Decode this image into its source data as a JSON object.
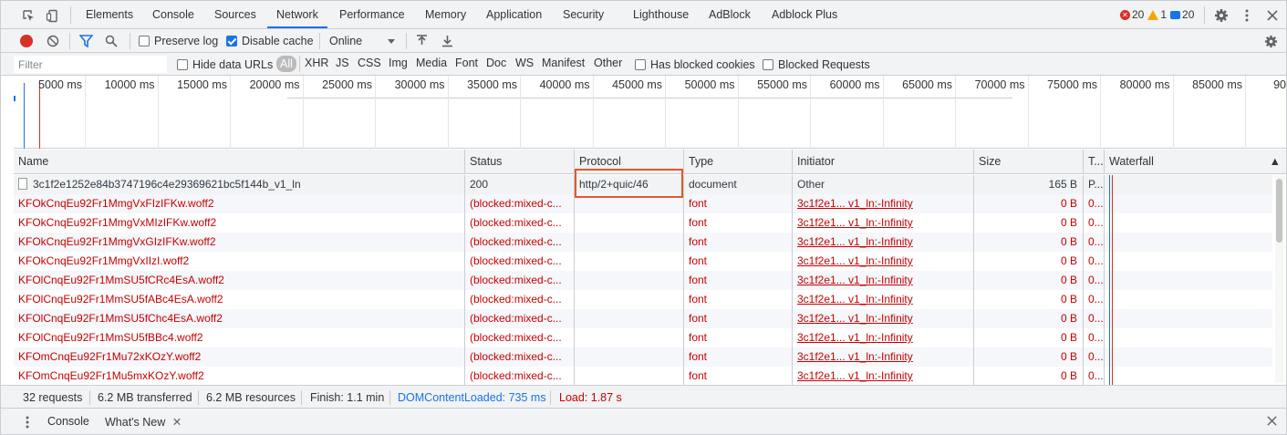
{
  "tabs": [
    {
      "label": "Elements"
    },
    {
      "label": "Console"
    },
    {
      "label": "Sources"
    },
    {
      "label": "Network"
    },
    {
      "label": "Performance"
    },
    {
      "label": "Memory"
    },
    {
      "label": "Application"
    },
    {
      "label": "Security"
    },
    {
      "label": "Lighthouse"
    },
    {
      "label": "AdBlock"
    },
    {
      "label": "Adblock Plus"
    }
  ],
  "active_tab": "Network",
  "counts": {
    "errors": "20",
    "warnings": "1",
    "info": "20"
  },
  "toolbar": {
    "preserve_log": "Preserve log",
    "disable_cache": "Disable cache",
    "throttling": "Online"
  },
  "filter": {
    "placeholder": "Filter",
    "hide_data_urls": "Hide data URLs",
    "types": [
      "All",
      "XHR",
      "JS",
      "CSS",
      "Img",
      "Media",
      "Font",
      "Doc",
      "WS",
      "Manifest",
      "Other"
    ],
    "has_blocked_cookies": "Has blocked cookies",
    "blocked_requests": "Blocked Requests"
  },
  "overview": {
    "ticks": [
      "5000 ms",
      "10000 ms",
      "15000 ms",
      "20000 ms",
      "25000 ms",
      "30000 ms",
      "35000 ms",
      "40000 ms",
      "45000 ms",
      "50000 ms",
      "55000 ms",
      "60000 ms",
      "65000 ms",
      "70000 ms",
      "75000 ms",
      "80000 ms",
      "85000 ms",
      "90"
    ]
  },
  "table": {
    "columns": {
      "name": "Name",
      "status": "Status",
      "protocol": "Protocol",
      "type": "Type",
      "initiator": "Initiator",
      "size": "Size",
      "time": "T...",
      "waterfall": "Waterfall"
    },
    "rows": [
      {
        "name": "3c1f2e1252e84b3747196c4e29369621bc5f144b_v1_ln",
        "status": "200",
        "protocol": "http/2+quic/46",
        "type": "document",
        "initiator": "Other",
        "size": "165 B",
        "time": "P...",
        "blocked": false
      },
      {
        "name": "KFOkCnqEu92Fr1MmgVxFIzIFKw.woff2",
        "status": "(blocked:mixed-c...",
        "protocol": "",
        "type": "font",
        "initiator": "3c1f2e1...  v1_ln:-Infinity",
        "size": "0 B",
        "time": "0...",
        "blocked": true
      },
      {
        "name": "KFOkCnqEu92Fr1MmgVxMIzIFKw.woff2",
        "status": "(blocked:mixed-c...",
        "protocol": "",
        "type": "font",
        "initiator": "3c1f2e1...  v1_ln:-Infinity",
        "size": "0 B",
        "time": "0...",
        "blocked": true
      },
      {
        "name": "KFOkCnqEu92Fr1MmgVxGIzIFKw.woff2",
        "status": "(blocked:mixed-c...",
        "protocol": "",
        "type": "font",
        "initiator": "3c1f2e1...  v1_ln:-Infinity",
        "size": "0 B",
        "time": "0...",
        "blocked": true
      },
      {
        "name": "KFOkCnqEu92Fr1MmgVxIIzI.woff2",
        "status": "(blocked:mixed-c...",
        "protocol": "",
        "type": "font",
        "initiator": "3c1f2e1...  v1_ln:-Infinity",
        "size": "0 B",
        "time": "0...",
        "blocked": true
      },
      {
        "name": "KFOlCnqEu92Fr1MmSU5fCRc4EsA.woff2",
        "status": "(blocked:mixed-c...",
        "protocol": "",
        "type": "font",
        "initiator": "3c1f2e1...  v1_ln:-Infinity",
        "size": "0 B",
        "time": "0...",
        "blocked": true
      },
      {
        "name": "KFOlCnqEu92Fr1MmSU5fABc4EsA.woff2",
        "status": "(blocked:mixed-c...",
        "protocol": "",
        "type": "font",
        "initiator": "3c1f2e1...  v1_ln:-Infinity",
        "size": "0 B",
        "time": "0...",
        "blocked": true
      },
      {
        "name": "KFOlCnqEu92Fr1MmSU5fChc4EsA.woff2",
        "status": "(blocked:mixed-c...",
        "protocol": "",
        "type": "font",
        "initiator": "3c1f2e1...  v1_ln:-Infinity",
        "size": "0 B",
        "time": "0...",
        "blocked": true
      },
      {
        "name": "KFOlCnqEu92Fr1MmSU5fBBc4.woff2",
        "status": "(blocked:mixed-c...",
        "protocol": "",
        "type": "font",
        "initiator": "3c1f2e1...  v1_ln:-Infinity",
        "size": "0 B",
        "time": "0...",
        "blocked": true
      },
      {
        "name": "KFOmCnqEu92Fr1Mu72xKOzY.woff2",
        "status": "(blocked:mixed-c...",
        "protocol": "",
        "type": "font",
        "initiator": "3c1f2e1...  v1_ln:-Infinity",
        "size": "0 B",
        "time": "0...",
        "blocked": true
      },
      {
        "name": "KFOmCnqEu92Fr1Mu5mxKOzY.woff2",
        "status": "(blocked:mixed-c...",
        "protocol": "",
        "type": "font",
        "initiator": "3c1f2e1...  v1_ln:-Infinity",
        "size": "0 B",
        "time": "0...",
        "blocked": true
      }
    ]
  },
  "status": {
    "requests": "32 requests",
    "transferred": "6.2 MB transferred",
    "resources": "6.2 MB resources",
    "finish": "Finish: 1.1 min",
    "dom_content_loaded": "DOMContentLoaded: 735 ms",
    "load": "Load: 1.87 s"
  },
  "drawer": {
    "tabs": [
      "Console",
      "What's New"
    ]
  },
  "colors": {
    "accent": "#1a73e8",
    "error": "#c80000",
    "highlight": "#e5562b"
  }
}
